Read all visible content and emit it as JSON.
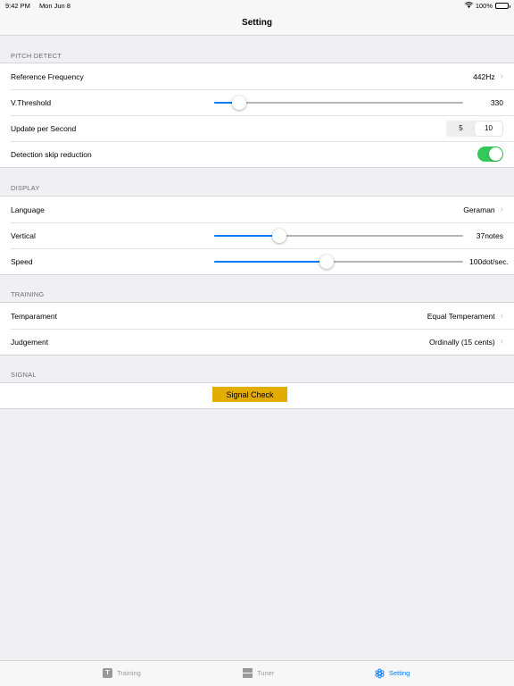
{
  "statusbar": {
    "time": "9:42 PM",
    "date": "Mon Jun 8",
    "battery": "100%"
  },
  "navbar": {
    "title": "Setting"
  },
  "pitch_detect": {
    "header": "PITCH DETECT",
    "reference_frequency": {
      "label": "Reference Frequency",
      "value": "442Hz"
    },
    "v_threshold": {
      "label": "V.Threshold",
      "value": "330",
      "slider_fraction": 0.1
    },
    "update_per_second": {
      "label": "Update per Second",
      "options": [
        "5",
        "10"
      ],
      "selected": "10"
    },
    "detection_skip": {
      "label": "Detection skip reduction",
      "on": true
    }
  },
  "display": {
    "header": "DISPLAY",
    "language": {
      "label": "Language",
      "value": "Geraman"
    },
    "vertical": {
      "label": "Vertical",
      "value": "37notes",
      "slider_fraction": 0.26
    },
    "speed": {
      "label": "Speed",
      "value": "100dot/sec.",
      "slider_fraction": 0.45
    }
  },
  "training": {
    "header": "TRAINING",
    "temparament": {
      "label": "Temparament",
      "value": "Equal Temperament"
    },
    "judgement": {
      "label": "Judgement",
      "value": "Ordinally (15 cents)"
    }
  },
  "signal": {
    "header": "SIGNAL",
    "button_label": "Signal Check",
    "button_color": "#e3ac00"
  },
  "tabbar": {
    "tabs": [
      {
        "label": "Training",
        "icon": "training-icon",
        "active": false
      },
      {
        "label": "Tuner",
        "icon": "tuner-icon",
        "active": false
      },
      {
        "label": "Setting",
        "icon": "gear-icon",
        "active": true
      }
    ]
  },
  "colors": {
    "accent": "#007aff",
    "switch_on": "#34c759"
  }
}
